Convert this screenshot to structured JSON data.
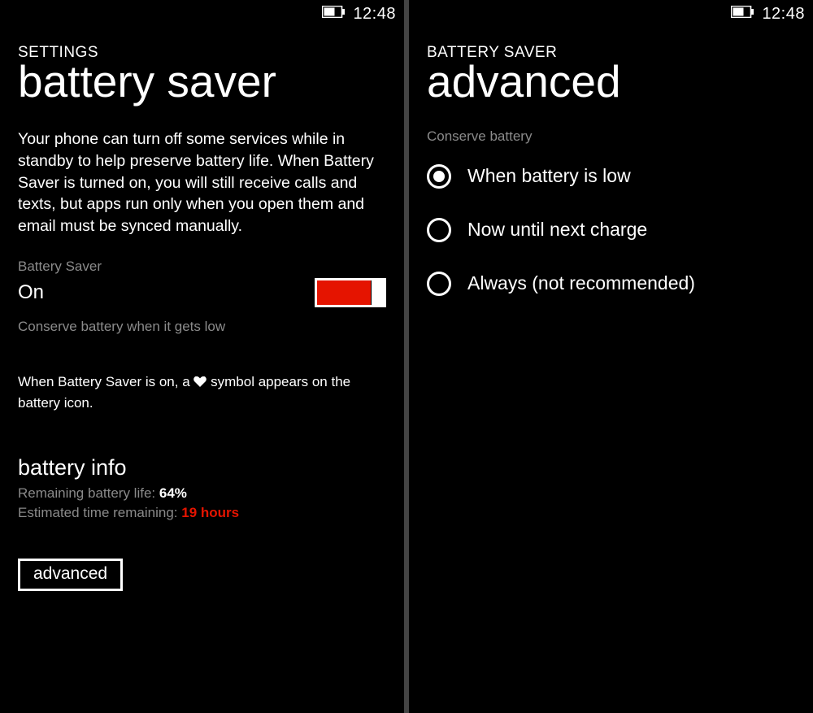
{
  "statusbar": {
    "time": "12:48"
  },
  "left": {
    "breadcrumb": "SETTINGS",
    "title": "battery saver",
    "description": "Your phone can turn off some services while in standby to help preserve battery life. When Battery Saver is turned on, you will still receive calls and texts, but apps run only when you open them and email must be synced manually.",
    "toggle_label": "Battery Saver",
    "toggle_value": "On",
    "toggle_on": true,
    "conserve_sub": "Conserve battery when it gets low",
    "info_prefix": "When Battery Saver is on, a ",
    "info_suffix": " symbol appears on the battery icon.",
    "battery_info_header": "battery info",
    "remaining_life_label": "Remaining battery life: ",
    "remaining_life_value": "64%",
    "est_time_label": "Estimated time remaining: ",
    "est_time_value": "19 hours",
    "advanced_button": "advanced"
  },
  "right": {
    "breadcrumb": "BATTERY SAVER",
    "title": "advanced",
    "group_label": "Conserve battery",
    "options": [
      {
        "label": "When battery is low",
        "selected": true
      },
      {
        "label": "Now until next charge",
        "selected": false
      },
      {
        "label": "Always (not recommended)",
        "selected": false
      }
    ]
  }
}
